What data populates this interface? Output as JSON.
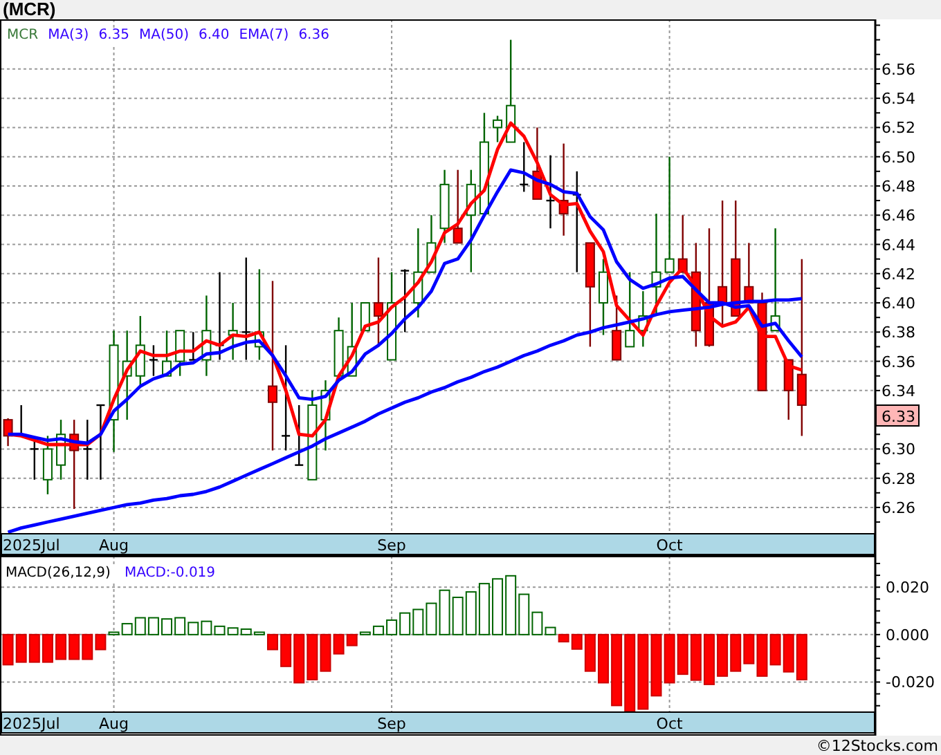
{
  "title": "(MCR)",
  "price_chart": {
    "legend": {
      "symbol": "MCR",
      "values": [
        "6.35",
        "6.40",
        "6.36"
      ]
    },
    "last_price": "6.33",
    "start_label": "2025Jul",
    "chart_data": {
      "type": "candlestick",
      "grid": true,
      "categories": [
        null,
        null,
        null,
        null,
        null,
        null,
        null,
        null,
        "Aug",
        null,
        null,
        null,
        null,
        null,
        null,
        null,
        null,
        null,
        null,
        null,
        null,
        null,
        null,
        null,
        null,
        null,
        null,
        null,
        null,
        "Sep",
        null,
        null,
        null,
        null,
        null,
        null,
        null,
        null,
        null,
        null,
        null,
        null,
        null,
        null,
        null,
        null,
        null,
        null,
        null,
        null,
        "Oct",
        null,
        null,
        null,
        null,
        null,
        null,
        null,
        null,
        null,
        null,
        null,
        null,
        null,
        null,
        null
      ],
      "ylim": [
        6.242,
        6.594
      ],
      "yticks": [
        {
          "value": 6.26,
          "label": "6.26"
        },
        {
          "value": 6.28,
          "label": "6.28"
        },
        {
          "value": 6.3,
          "label": "6.30"
        },
        {
          "value": 6.34,
          "label": "6.34"
        },
        {
          "value": 6.36,
          "label": "6.36"
        },
        {
          "value": 6.38,
          "label": "6.38"
        },
        {
          "value": 6.4,
          "label": "6.40"
        },
        {
          "value": 6.42,
          "label": "6.42"
        },
        {
          "value": 6.44,
          "label": "6.44"
        },
        {
          "value": 6.46,
          "label": "6.46"
        },
        {
          "value": 6.48,
          "label": "6.48"
        },
        {
          "value": 6.5,
          "label": "6.50"
        },
        {
          "value": 6.52,
          "label": "6.52"
        },
        {
          "value": 6.54,
          "label": "6.54"
        },
        {
          "value": 6.56,
          "label": "6.56"
        }
      ],
      "ohlc": [
        [
          6.32,
          6.321,
          6.302,
          6.309
        ],
        [
          6.31,
          6.33,
          6.309,
          6.31
        ],
        [
          6.3,
          6.308,
          6.279,
          6.3
        ],
        [
          6.279,
          6.309,
          6.269,
          6.3
        ],
        [
          6.289,
          6.32,
          6.279,
          6.31
        ],
        [
          6.31,
          6.32,
          6.259,
          6.299
        ],
        [
          6.3,
          6.32,
          6.279,
          6.3
        ],
        [
          6.33,
          6.33,
          6.279,
          6.33
        ],
        [
          6.32,
          6.381,
          6.298,
          6.371
        ],
        [
          6.35,
          6.381,
          6.32,
          6.36
        ],
        [
          6.35,
          6.391,
          6.342,
          6.371
        ],
        [
          6.361,
          6.371,
          6.35,
          6.361
        ],
        [
          6.35,
          6.381,
          6.35,
          6.36
        ],
        [
          6.36,
          6.381,
          6.35,
          6.381
        ],
        [
          6.361,
          6.38,
          6.361,
          6.361
        ],
        [
          6.361,
          6.405,
          6.35,
          6.381
        ],
        [
          6.371,
          6.421,
          6.361,
          6.371
        ],
        [
          6.378,
          6.4,
          6.361,
          6.381
        ],
        [
          6.38,
          6.431,
          6.361,
          6.38
        ],
        [
          6.37,
          6.423,
          6.361,
          6.38
        ],
        [
          6.343,
          6.415,
          6.299,
          6.332
        ],
        [
          6.309,
          6.371,
          6.299,
          6.309
        ],
        [
          6.289,
          6.33,
          6.289,
          6.289
        ],
        [
          6.279,
          6.34,
          6.279,
          6.33
        ],
        [
          6.32,
          6.347,
          6.299,
          6.34
        ],
        [
          6.35,
          6.39,
          6.35,
          6.381
        ],
        [
          6.35,
          6.4,
          6.35,
          6.37
        ],
        [
          6.381,
          6.4,
          6.381,
          6.4
        ],
        [
          6.4,
          6.431,
          6.37,
          6.391
        ],
        [
          6.361,
          6.421,
          6.361,
          6.4
        ],
        [
          6.422,
          6.423,
          6.38,
          6.422
        ],
        [
          6.4,
          6.451,
          6.39,
          6.421
        ],
        [
          6.421,
          6.46,
          6.421,
          6.441
        ],
        [
          6.451,
          6.491,
          6.441,
          6.481
        ],
        [
          6.451,
          6.491,
          6.441,
          6.441
        ],
        [
          6.46,
          6.491,
          6.421,
          6.481
        ],
        [
          6.461,
          6.53,
          6.461,
          6.51
        ],
        [
          6.52,
          6.528,
          6.51,
          6.525
        ],
        [
          6.51,
          6.58,
          6.51,
          6.535
        ],
        [
          6.481,
          6.51,
          6.476,
          6.481
        ],
        [
          6.49,
          6.52,
          6.471,
          6.471
        ],
        [
          6.47,
          6.501,
          6.451,
          6.47
        ],
        [
          6.47,
          6.509,
          6.446,
          6.461
        ],
        [
          6.474,
          6.49,
          6.421,
          6.474
        ],
        [
          6.441,
          6.441,
          6.37,
          6.411
        ],
        [
          6.4,
          6.43,
          6.378,
          6.421
        ],
        [
          6.381,
          6.405,
          6.361,
          6.361
        ],
        [
          6.37,
          6.421,
          6.37,
          6.381
        ],
        [
          6.381,
          6.408,
          6.37,
          6.391
        ],
        [
          6.411,
          6.461,
          6.391,
          6.421
        ],
        [
          6.421,
          6.5,
          6.421,
          6.43
        ],
        [
          6.43,
          6.46,
          6.421,
          6.421
        ],
        [
          6.421,
          6.441,
          6.37,
          6.381
        ],
        [
          6.4,
          6.451,
          6.37,
          6.371
        ],
        [
          6.411,
          6.47,
          6.385,
          6.4
        ],
        [
          6.43,
          6.47,
          6.391,
          6.391
        ],
        [
          6.411,
          6.441,
          6.4,
          6.4
        ],
        [
          6.4,
          6.407,
          6.34,
          6.34
        ],
        [
          6.381,
          6.451,
          6.381,
          6.391
        ],
        [
          6.361,
          6.361,
          6.32,
          6.34
        ],
        [
          6.351,
          6.43,
          6.309,
          6.33
        ],
        null,
        null,
        null,
        null,
        null
      ],
      "series": [
        {
          "name": "MA(3)",
          "type": "line",
          "color": "#ff0000",
          "values": [
            6.31,
            6.309,
            6.306,
            6.303,
            6.303,
            6.303,
            6.303,
            6.31,
            6.334,
            6.354,
            6.367,
            6.364,
            6.364,
            6.367,
            6.367,
            6.374,
            6.371,
            6.378,
            6.377,
            6.38,
            6.364,
            6.34,
            6.31,
            6.309,
            6.32,
            6.35,
            6.364,
            6.384,
            6.387,
            6.397,
            6.404,
            6.414,
            6.428,
            6.448,
            6.454,
            6.468,
            6.477,
            6.505,
            6.523,
            6.514,
            6.496,
            6.474,
            6.467,
            6.468,
            6.449,
            6.435,
            6.398,
            6.388,
            6.378,
            6.398,
            6.414,
            6.424,
            6.411,
            6.391,
            6.384,
            6.387,
            6.397,
            6.377,
            6.377,
            6.357,
            6.354,
            null,
            null,
            null,
            null,
            null
          ]
        },
        {
          "name": "MA(50)",
          "type": "line",
          "color": "#0000ff",
          "values": [
            6.243,
            6.246,
            6.248,
            6.25,
            6.252,
            6.254,
            6.256,
            6.258,
            6.26,
            6.262,
            6.263,
            6.265,
            6.266,
            6.268,
            6.269,
            6.271,
            6.274,
            6.278,
            6.282,
            6.286,
            6.29,
            6.294,
            6.298,
            6.302,
            6.307,
            6.311,
            6.315,
            6.319,
            6.324,
            6.328,
            6.332,
            6.335,
            6.339,
            6.342,
            6.346,
            6.349,
            6.353,
            6.356,
            6.36,
            6.364,
            6.367,
            6.371,
            6.374,
            6.378,
            6.38,
            6.383,
            6.385,
            6.387,
            6.389,
            6.392,
            6.394,
            6.395,
            6.396,
            6.397,
            6.399,
            6.4,
            6.401,
            6.401,
            6.402,
            6.402,
            6.403,
            null,
            null,
            null,
            null,
            null
          ]
        },
        {
          "name": "EMA(7)",
          "type": "line",
          "color": "#0000ff",
          "values": [
            6.31,
            6.31,
            6.308,
            6.306,
            6.307,
            6.305,
            6.304,
            6.31,
            6.326,
            6.334,
            6.343,
            6.348,
            6.351,
            6.358,
            6.359,
            6.365,
            6.366,
            6.37,
            6.373,
            6.374,
            6.364,
            6.35,
            6.335,
            6.334,
            6.336,
            6.347,
            6.353,
            6.365,
            6.371,
            6.379,
            6.389,
            6.397,
            6.408,
            6.427,
            6.43,
            6.443,
            6.46,
            6.476,
            6.491,
            6.489,
            6.484,
            6.481,
            6.476,
            6.475,
            6.459,
            6.45,
            6.428,
            6.416,
            6.41,
            6.413,
            6.417,
            6.418,
            6.409,
            6.4,
            6.4,
            6.397,
            6.398,
            6.384,
            6.386,
            6.374,
            6.363,
            null,
            null,
            null,
            null,
            null
          ]
        }
      ]
    }
  },
  "macd_chart": {
    "reading": "MACD:-0.019",
    "start_label": "2025Jul",
    "chart_data": {
      "type": "bar",
      "title": "MACD(26,12,9)",
      "grid": true,
      "categories": [
        null,
        null,
        null,
        null,
        null,
        null,
        null,
        null,
        "Aug",
        null,
        null,
        null,
        null,
        null,
        null,
        null,
        null,
        null,
        null,
        null,
        null,
        null,
        null,
        null,
        null,
        null,
        null,
        null,
        null,
        "Sep",
        null,
        null,
        null,
        null,
        null,
        null,
        null,
        null,
        null,
        null,
        null,
        null,
        null,
        null,
        null,
        null,
        null,
        null,
        null,
        null,
        "Oct",
        null,
        null,
        null,
        null,
        null,
        null,
        null,
        null,
        null,
        null,
        null,
        null,
        null,
        null,
        null
      ],
      "ylim": [
        -0.0327,
        0.0332
      ],
      "yticks": [
        {
          "value": 0.02,
          "label": "0.020"
        },
        {
          "value": 0,
          "label": "0.000"
        },
        {
          "value": -0.02,
          "label": "-0.020"
        }
      ],
      "values": [
        -0.0127,
        -0.0116,
        -0.0116,
        -0.0116,
        -0.0104,
        -0.0104,
        -0.0104,
        -0.0063,
        0.001,
        0.0046,
        0.0071,
        0.0071,
        0.0066,
        0.0071,
        0.0051,
        0.0056,
        0.0035,
        0.0028,
        0.0023,
        0.001,
        -0.0063,
        -0.0134,
        -0.0203,
        -0.019,
        -0.0154,
        -0.0081,
        -0.0046,
        0.001,
        0.0035,
        0.0061,
        0.0091,
        0.0106,
        0.0132,
        0.0187,
        0.0157,
        0.018,
        0.0215,
        0.0235,
        0.0248,
        0.017,
        0.0094,
        0.003,
        -0.003,
        -0.0061,
        -0.0154,
        -0.0203,
        -0.0299,
        -0.0324,
        -0.0314,
        -0.0258,
        -0.0203,
        -0.0167,
        -0.0192,
        -0.021,
        -0.0175,
        -0.0154,
        -0.0122,
        -0.0175,
        -0.0127,
        -0.0157,
        -0.019,
        null,
        null,
        null,
        null,
        null
      ]
    }
  },
  "footer": "©12Stocks.com"
}
